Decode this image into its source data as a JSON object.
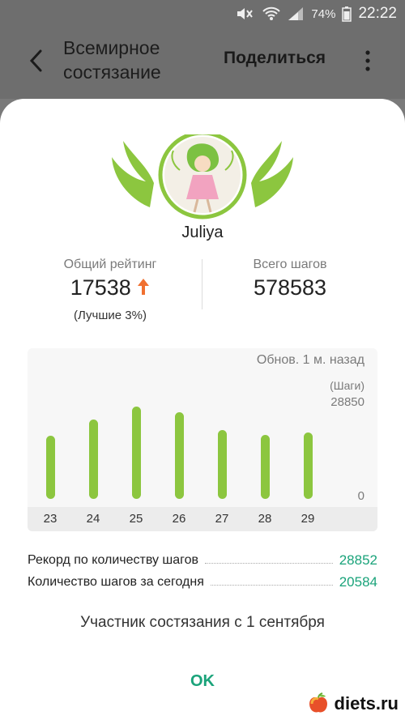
{
  "status_bar": {
    "battery": "74%",
    "time": "22:22"
  },
  "appbar": {
    "title": "Всемирное состязание",
    "share": "Поделиться"
  },
  "user": {
    "name": "Juliya"
  },
  "stats": {
    "rank_label": "Общий рейтинг",
    "rank_value": "17538",
    "rank_note": "(Лучшие 3%)",
    "steps_label": "Всего шагов",
    "steps_value": "578583"
  },
  "chart_data": {
    "type": "bar",
    "updated": "Обнов. 1 м. назад",
    "unit": "(Шаги)",
    "y_max_label": "28850",
    "y_min_label": "0",
    "categories": [
      "23",
      "24",
      "25",
      "26",
      "27",
      "28",
      "29"
    ],
    "values": [
      17500,
      22000,
      25800,
      24200,
      19200,
      17900,
      18500
    ],
    "ylim": [
      0,
      28850
    ]
  },
  "records": {
    "record_label": "Рекорд по количеству шагов",
    "record_value": "28852",
    "today_label": "Количество шагов за сегодня",
    "today_value": "20584"
  },
  "since": "Участник состязания с 1 сентября",
  "ok": "OK",
  "watermark": "diets.ru",
  "colors": {
    "accent": "#1aa37a",
    "bar": "#8cc63f",
    "rank_up": "#f07030"
  }
}
